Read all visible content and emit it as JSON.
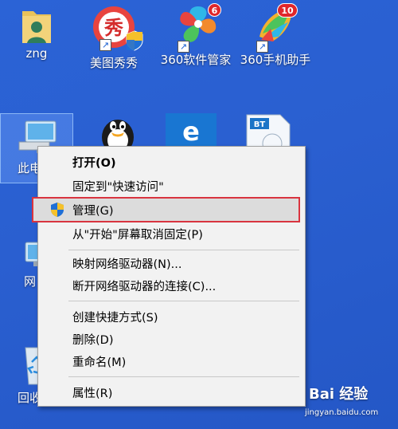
{
  "desktop": {
    "icons": [
      {
        "label": "zng",
        "icon": "user-folder-icon"
      },
      {
        "label": "美图秀秀",
        "icon": "meitu-icon"
      },
      {
        "label": "360软件管家",
        "icon": "360-software-manager-icon",
        "badge": "6"
      },
      {
        "label": "360手机助手",
        "icon": "360-phone-assistant-icon",
        "badge": "10"
      },
      {
        "label": "此电",
        "icon": "this-pc-icon"
      },
      {
        "label": "网",
        "icon": "network-icon"
      },
      {
        "label": "回收",
        "icon": "recycle-bin-icon"
      }
    ]
  },
  "context_menu": {
    "items": [
      {
        "label": "打开(O)",
        "bold": true
      },
      {
        "label": "固定到\"快速访问\""
      },
      {
        "label": "管理(G)",
        "highlighted": true,
        "icon": "uac-shield-icon"
      },
      {
        "label": "从\"开始\"屏幕取消固定(P)"
      },
      {
        "label": "映射网络驱动器(N)..."
      },
      {
        "label": "断开网络驱动器的连接(C)..."
      },
      {
        "label": "创建快捷方式(S)"
      },
      {
        "label": "删除(D)"
      },
      {
        "label": "重命名(M)"
      },
      {
        "label": "属性(R)"
      }
    ]
  },
  "watermark": {
    "text": "Bai 经验",
    "url": "jingyan.baidu.com"
  },
  "colors": {
    "desktop": "#2a5fd0",
    "menu_bg": "#f2f2f2",
    "highlight_border": "#d9343f"
  }
}
